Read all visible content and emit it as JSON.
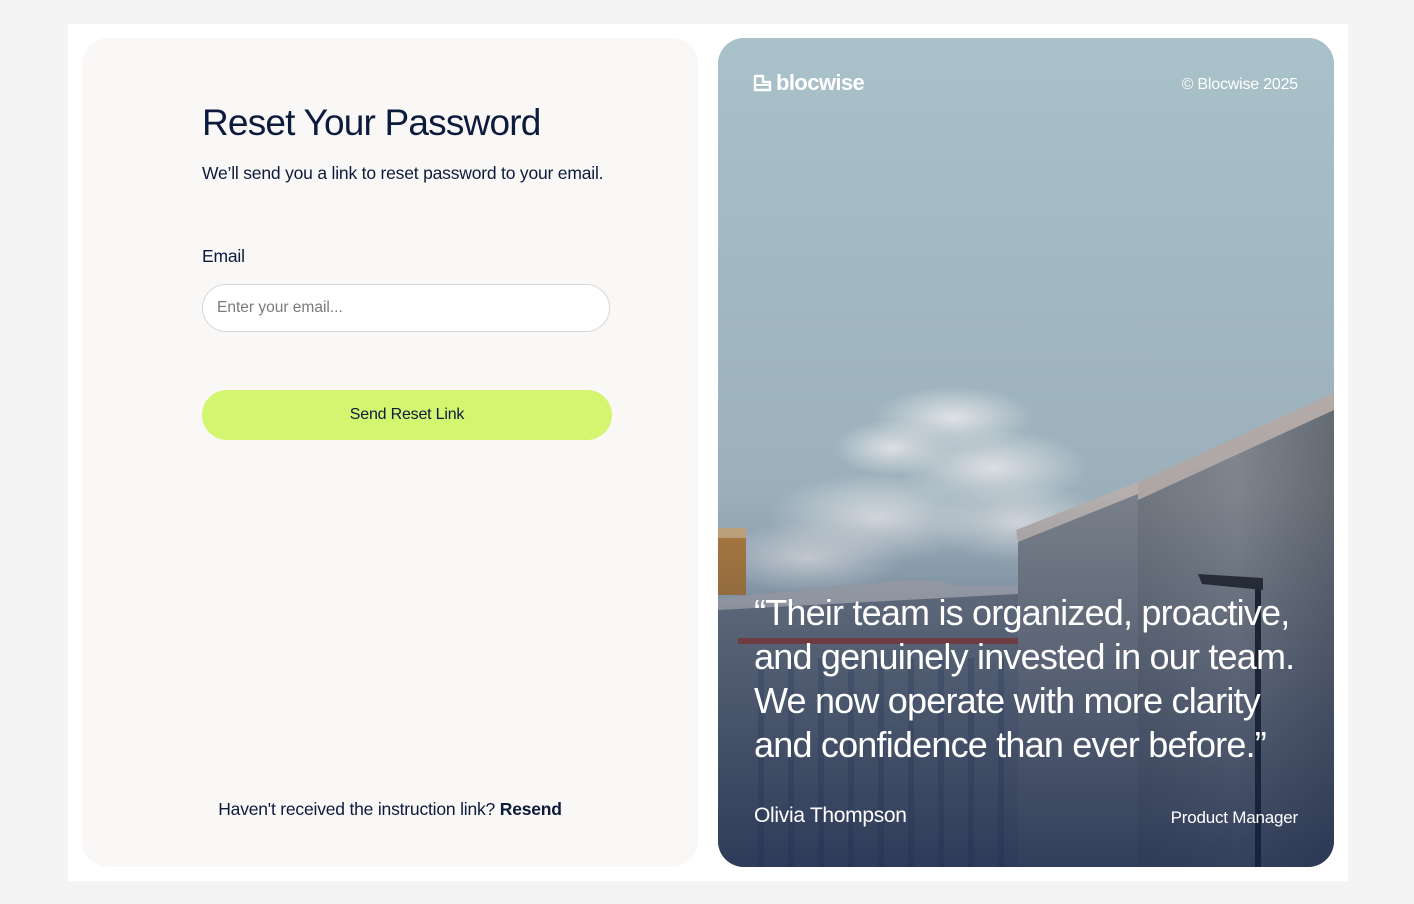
{
  "reset": {
    "title": "Reset Your Password",
    "subtitle": "We’ll send you a link to reset password to your email.",
    "email_label": "Email",
    "email_placeholder": "Enter your email...",
    "email_value": "",
    "send_label": "Send Reset Link",
    "resend_prompt": "Haven't received the instruction link?",
    "resend_link": "Resend"
  },
  "showcase": {
    "brand": "blocwise",
    "brand_icon": "building-logo-icon",
    "copyright": "© Blocwise 2025",
    "quote": "“Their team is organized, proactive, and genuinely invested in our team. We now operate with more clarity and confidence than ever before.”",
    "author_name": "Olivia Thompson",
    "author_role": "Product Manager"
  },
  "colors": {
    "text_navy": "#0c1a3c",
    "accent_lime": "#d4f56f",
    "sky": "#aac2ca",
    "card_bg": "#f9f8f6"
  }
}
